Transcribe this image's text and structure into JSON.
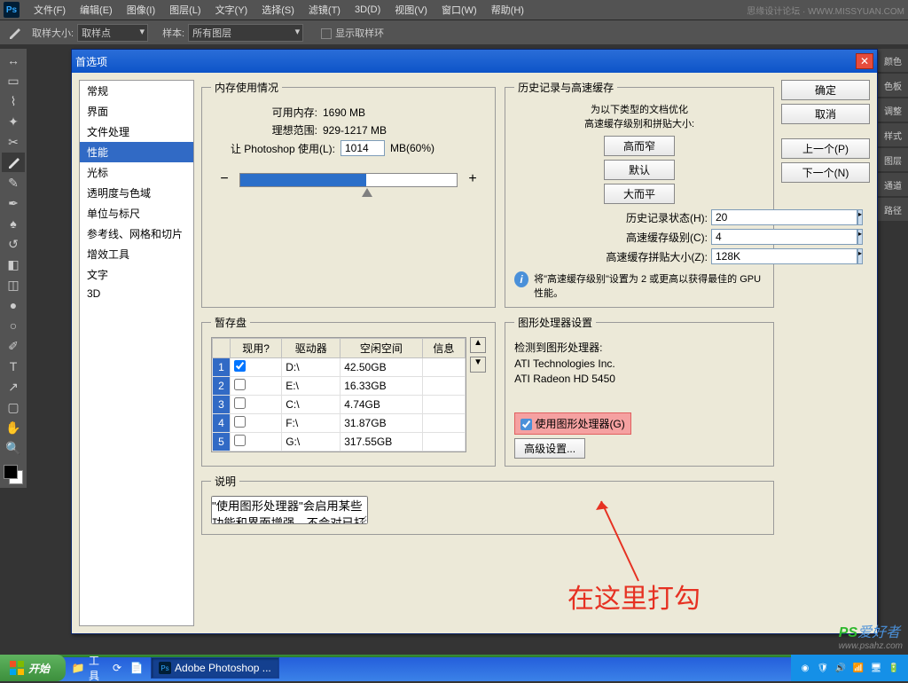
{
  "menubar": {
    "logo": "Ps",
    "items": [
      "文件(F)",
      "编辑(E)",
      "图像(I)",
      "图层(L)",
      "文字(Y)",
      "选择(S)",
      "滤镜(T)",
      "3D(D)",
      "视图(V)",
      "窗口(W)",
      "帮助(H)"
    ],
    "right": "思缘设计论坛 · WWW.MISSYUAN.COM"
  },
  "optbar": {
    "size_label": "取样大小:",
    "size_value": "取样点",
    "sample_label": "样本:",
    "sample_value": "所有图层",
    "show_label": "显示取样环"
  },
  "right_tabs": [
    "颜色",
    "色板",
    "调整",
    "样式",
    "图层",
    "通道",
    "路径"
  ],
  "dialog": {
    "title": "首选项",
    "categories": [
      "常规",
      "界面",
      "文件处理",
      "性能",
      "光标",
      "透明度与色域",
      "单位与标尺",
      "参考线、网格和切片",
      "增效工具",
      "文字",
      "3D"
    ],
    "selected_cat": "性能",
    "memory": {
      "legend": "内存使用情况",
      "avail_label": "可用内存:",
      "avail_value": "1690 MB",
      "ideal_label": "理想范围:",
      "ideal_value": "929-1217 MB",
      "use_label": "让 Photoshop 使用(L):",
      "use_value": "1014",
      "use_unit": "MB(60%)"
    },
    "history": {
      "legend": "历史记录与高速缓存",
      "hint1": "为以下类型的文档优化",
      "hint2": "高速缓存级别和拼贴大小:",
      "btn_tall": "高而窄",
      "btn_default": "默认",
      "btn_big": "大而平",
      "states_label": "历史记录状态(H):",
      "states_value": "20",
      "cache_label": "高速缓存级别(C):",
      "cache_value": "4",
      "tile_label": "高速缓存拼贴大小(Z):",
      "tile_value": "128K",
      "info": "将\"高速缓存级别\"设置为 2 或更高以获得最佳的 GPU 性能。"
    },
    "scratch": {
      "legend": "暂存盘",
      "headers": [
        "现用?",
        "驱动器",
        "空闲空间",
        "信息"
      ],
      "rows": [
        {
          "n": "1",
          "active": true,
          "drive": "D:\\",
          "free": "42.50GB",
          "info": ""
        },
        {
          "n": "2",
          "active": false,
          "drive": "E:\\",
          "free": "16.33GB",
          "info": ""
        },
        {
          "n": "3",
          "active": false,
          "drive": "C:\\",
          "free": "4.74GB",
          "info": ""
        },
        {
          "n": "4",
          "active": false,
          "drive": "F:\\",
          "free": "31.87GB",
          "info": ""
        },
        {
          "n": "5",
          "active": false,
          "drive": "G:\\",
          "free": "317.55GB",
          "info": ""
        }
      ]
    },
    "gpu": {
      "legend": "图形处理器设置",
      "detected_label": "检测到图形处理器:",
      "vendor": "ATI Technologies Inc.",
      "model": "ATI Radeon HD 5450",
      "enable_label": "使用图形处理器(G)",
      "adv_btn": "高级设置..."
    },
    "desc": {
      "legend": "说明",
      "text": "\"使用图形处理器\"会启用某些功能和界面增强。不会对已打开的文档启用 OpenGL。\n功能:\"旋转视图\"工具、\"鸟瞰缩放\"、\"像素网格\"、\"轻击平移\"、\"细微缩放\"、\"HUD 拾色器\"和\"丰富光标\"信息、\"取样环\"(\"吸管工具\")、\"画布画笔大小调整\"、\"硬毛刷笔尖预览\"、\"油画\"、\"自适应广角\"、\"光效库\"和所有 3D 功能\n增强:\"模糊画廊\"(仅用于 OpenCL)、\"液化\"、\"操控变形\"、平滑的平移和缩放、画布边界投影、\"绘画\"性能、\"变换\"/\"变形\""
    },
    "buttons": {
      "ok": "确定",
      "cancel": "取消",
      "prev": "上一个(P)",
      "next": "下一个(N)"
    }
  },
  "annotation": "在这里打勾",
  "taskbar": {
    "start": "开始",
    "ql": [
      "工具",
      "⟳"
    ],
    "items": [
      {
        "icon": "Ps",
        "label": "Adobe Photoshop ..."
      }
    ],
    "clock": "",
    "tray_icons": [
      "◉",
      "🔒",
      "🕪",
      "📶",
      "",
      "🔋"
    ]
  },
  "watermark": {
    "brand": "PS",
    "suffix": "爱好者",
    "url": "www.psahz.com"
  }
}
